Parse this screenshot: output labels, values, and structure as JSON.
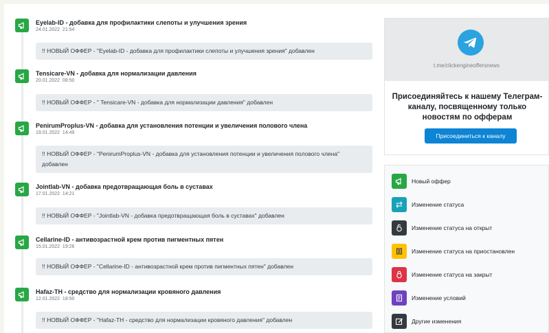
{
  "feed": [
    {
      "title": "Eyelab-ID - добавка для профилактики слепоты и улучшения зрения",
      "date": "24.01.2022  21:54",
      "message": "!! НОВЫЙ ОФФЕР - \"Eyelab-ID - добавка для профилактики слепоты и улучшения зрения\" добавлен"
    },
    {
      "title": "Tensicare-VN - добавка для нормализации давления",
      "date": "20.01.2022  08:50",
      "message": "!! НОВЫЙ ОФФЕР - \" Tensicare-VN - добавка для нормализации давления\" добавлен"
    },
    {
      "title": "PenirumProplus-VN - добавка для установления потенции и увеличения полового члена",
      "date": "19.01.2022  14:49",
      "message": "!! НОВЫЙ ОФФЕР - \"PenirumProplus-VN - добавка для установления потенции и увеличения полового члена\" добавлен"
    },
    {
      "title": "Jointlab-VN - добавка предотвращающая боль в суставах",
      "date": "17.01.2022  14:21",
      "message": "!! НОВЫЙ ОФФЕР - \"Jointlab-VN - добавка предотвращающая боль в суставах\" добавлен"
    },
    {
      "title": "Cellarine-ID - антивозрастной крем против пигментных пятен",
      "date": "15.01.2022  19:26",
      "message": "!! НОВЫЙ ОФФЕР - \"Cellarine-ID - антивозрастной крем против пигментных пятен\" добавлен"
    },
    {
      "title": "Hafaz-TH - средство для нормализации кровяного давления",
      "date": "12.01.2022  18:50",
      "message": "!! НОВЫЙ ОФФЕР - \"Hafaz-TH - средство для нормализации кровяного давления\" добавлен"
    }
  ],
  "telegram": {
    "link": "t.me/clickengineoffersnews",
    "text": "Присоединяйтесь к нашему Телеграм-каналу, посвященному только новостям по офферам",
    "button": "Присоединиться к каналу",
    "icon": "telegram-icon",
    "color": "#2aa3e0"
  },
  "legend": [
    {
      "label": "Новый оффер",
      "icon": "megaphone-icon",
      "color": "#28a745"
    },
    {
      "label": "Изменение статуса",
      "icon": "swap-arrows-icon",
      "color": "#17a2b8"
    },
    {
      "label": "Изменение статуса на открыт",
      "icon": "lock-open-icon",
      "color": "#343a40"
    },
    {
      "label": "Изменение статуса на приостановлен",
      "icon": "pause-icon",
      "color": "#ffc107"
    },
    {
      "label": "Изменение статуса на закрыт",
      "icon": "lock-closed-icon",
      "color": "#dc3545"
    },
    {
      "label": "Изменение условий",
      "icon": "document-icon",
      "color": "#6f42c1"
    },
    {
      "label": "Другие изменения",
      "icon": "edit-icon",
      "color": "#343a40"
    }
  ]
}
